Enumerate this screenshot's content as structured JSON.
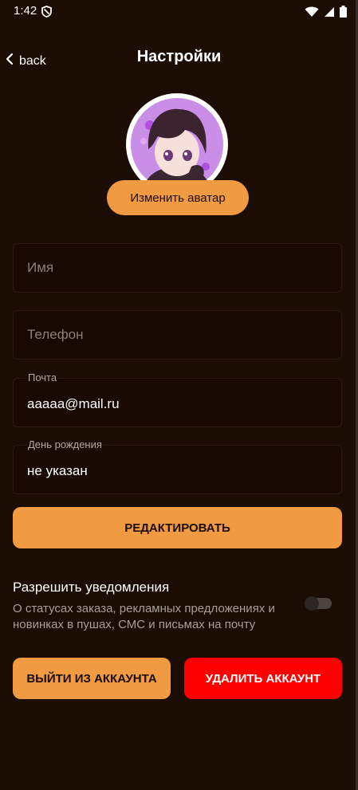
{
  "status_bar": {
    "time": "1:42",
    "icons": [
      "shield-icon",
      "wifi-icon",
      "signal-icon",
      "battery-icon"
    ]
  },
  "header": {
    "back_label": "back",
    "title": "Настройки"
  },
  "avatar": {
    "change_label": "Изменить аватар"
  },
  "form": {
    "name_placeholder": "Имя",
    "phone_placeholder": "Телефон",
    "email_label": "Почта",
    "email_value": "aaaaa@mail.ru",
    "birthday_label": "День рождения",
    "birthday_value": "не указан"
  },
  "edit_button": "РЕДАКТИРОВАТЬ",
  "notifications": {
    "title": "Разрешить уведомления",
    "description": "О статусах заказа, рекламных предложениях и новинках в пушах, СМС и письмах на почту",
    "enabled": false
  },
  "actions": {
    "logout_label": "ВЫЙТИ ИЗ АККАУНТА",
    "delete_label": "УДАЛИТЬ АККАУНТ"
  },
  "colors": {
    "background": "#1b0c04",
    "accent": "#f09a42",
    "danger": "#ff0000",
    "text": "#ffffff"
  }
}
